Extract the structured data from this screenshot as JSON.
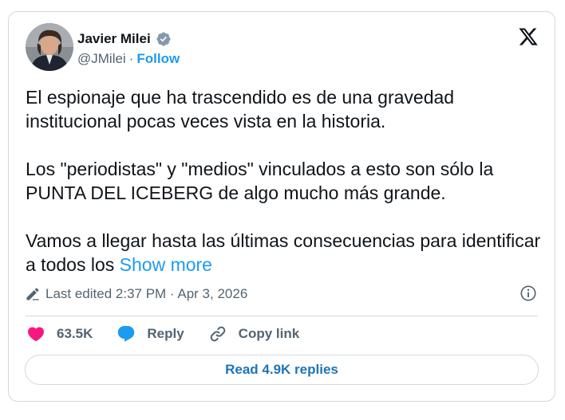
{
  "author": {
    "name": "Javier Milei",
    "handle": "@JMilei",
    "separator": "·",
    "follow_label": "Follow"
  },
  "tweet": {
    "paragraphs": [
      "El espionaje que ha trascendido es de una gravedad institucional pocas veces vista en la historia.",
      "Los \"periodistas\" y \"medios\" vinculados a esto son sólo la PUNTA DEL ICEBERG de algo mucho más grande.",
      "Vamos a llegar hasta las últimas consecuencias para identificar a todos los"
    ],
    "show_more": "Show more"
  },
  "edited": {
    "text": "Last edited 2:37 PM · Apr 3, 2026"
  },
  "actions": {
    "likes": "63.5K",
    "reply": "Reply",
    "copy_link": "Copy link"
  },
  "replies_button": "Read 4.9K replies",
  "colors": {
    "accent": "#1d9bf0",
    "like": "#f91880",
    "muted": "#536471",
    "border": "#cfd9de"
  },
  "icons": [
    "verified-badge-icon",
    "x-logo-icon",
    "edit-pencil-icon",
    "info-icon",
    "heart-icon",
    "reply-bubble-icon",
    "link-icon"
  ]
}
